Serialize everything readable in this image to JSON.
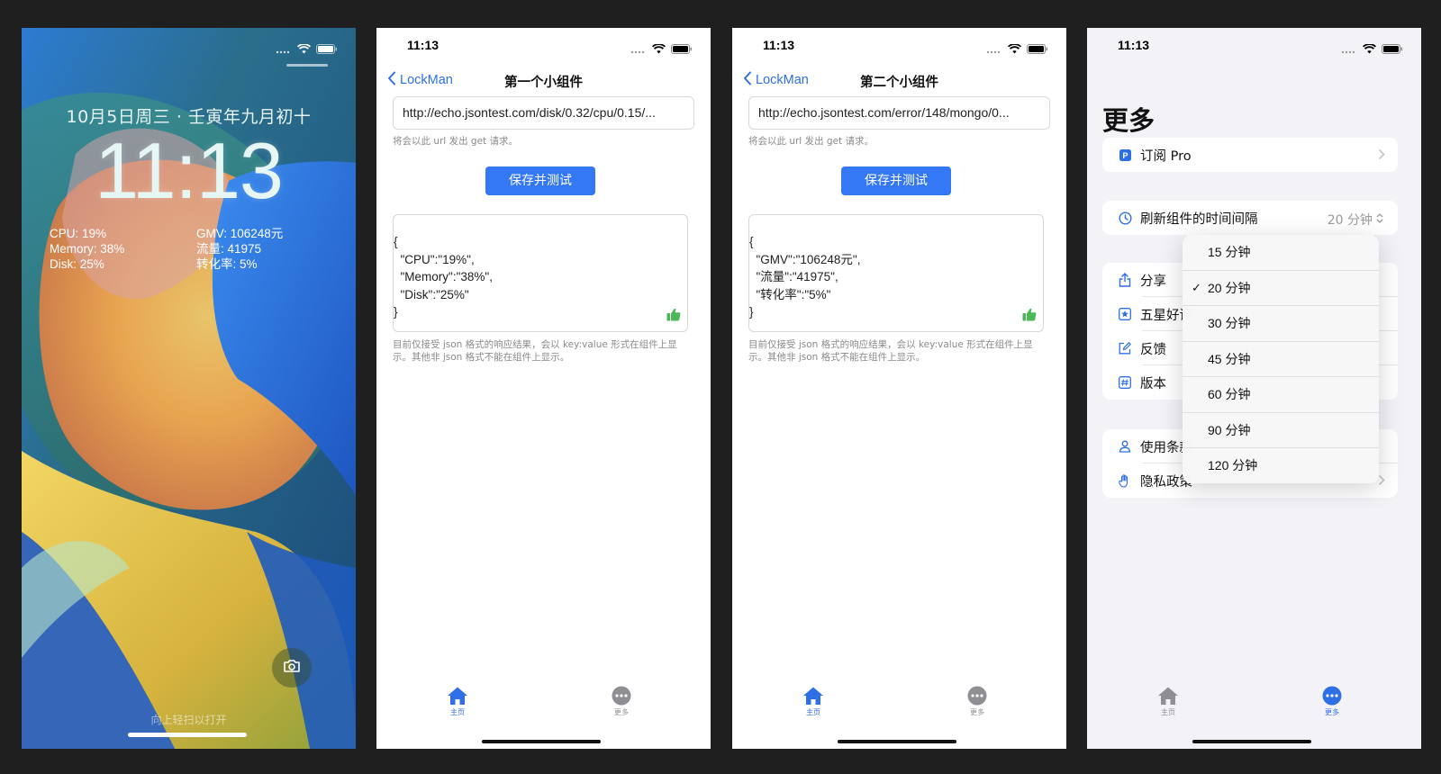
{
  "lock_screen": {
    "date": "10月5日周三 · 壬寅年九月初十",
    "time": "11:13",
    "widget_left": [
      "CPU: 19%",
      "Memory: 38%",
      "Disk: 25%"
    ],
    "widget_right": [
      "GMV: 106248元",
      "流量: 41975",
      "转化率: 5%"
    ],
    "unlock_hint": "向上轻扫以打开"
  },
  "status_time": "11:13",
  "screen_one": {
    "back_label": "LockMan",
    "title": "第一个小组件",
    "url": "http://echo.jsontest.com/disk/0.32/cpu/0.15/...",
    "url_hint": "将会以此 url 发出 get 请求。",
    "save_button": "保存并测试",
    "result": "{\n  \"CPU\":\"19%\",\n  \"Memory\":\"38%\",\n  \"Disk\":\"25%\"\n}",
    "note": "目前仅接受 json 格式的响应结果，会以 key:value 形式在组件上显示。其他非 json 格式不能在组件上显示。"
  },
  "screen_two": {
    "back_label": "LockMan",
    "title": "第二个小组件",
    "url": "http://echo.jsontest.com/error/148/mongo/0...",
    "url_hint": "将会以此 url 发出 get 请求。",
    "save_button": "保存并测试",
    "result": "{\n  \"GMV\":\"106248元\",\n  \"流量\":\"41975\",\n  \"转化率\":\"5%\"\n}",
    "note": "目前仅接受 json 格式的响应结果，会以 key:value 形式在组件上显示。其他非 json 格式不能在组件上显示。"
  },
  "tabs": {
    "home": "主页",
    "more": "更多"
  },
  "more_screen": {
    "title": "更多",
    "subscribe": "订阅 Pro",
    "refresh_label": "刷新组件的时间间隔",
    "refresh_value": "20 分钟",
    "items": [
      "分享",
      "五星好评",
      "反馈",
      "版本"
    ],
    "legal": [
      "使用条款",
      "隐私政策"
    ],
    "interval_options": [
      "15 分钟",
      "20 分钟",
      "30 分钟",
      "45 分钟",
      "60 分钟",
      "90 分钟",
      "120 分钟"
    ],
    "selected_option": "20 分钟"
  },
  "colors": {
    "accent": "#3478f6",
    "thumb": "#4cb85a",
    "background": "#1f1f1f"
  }
}
